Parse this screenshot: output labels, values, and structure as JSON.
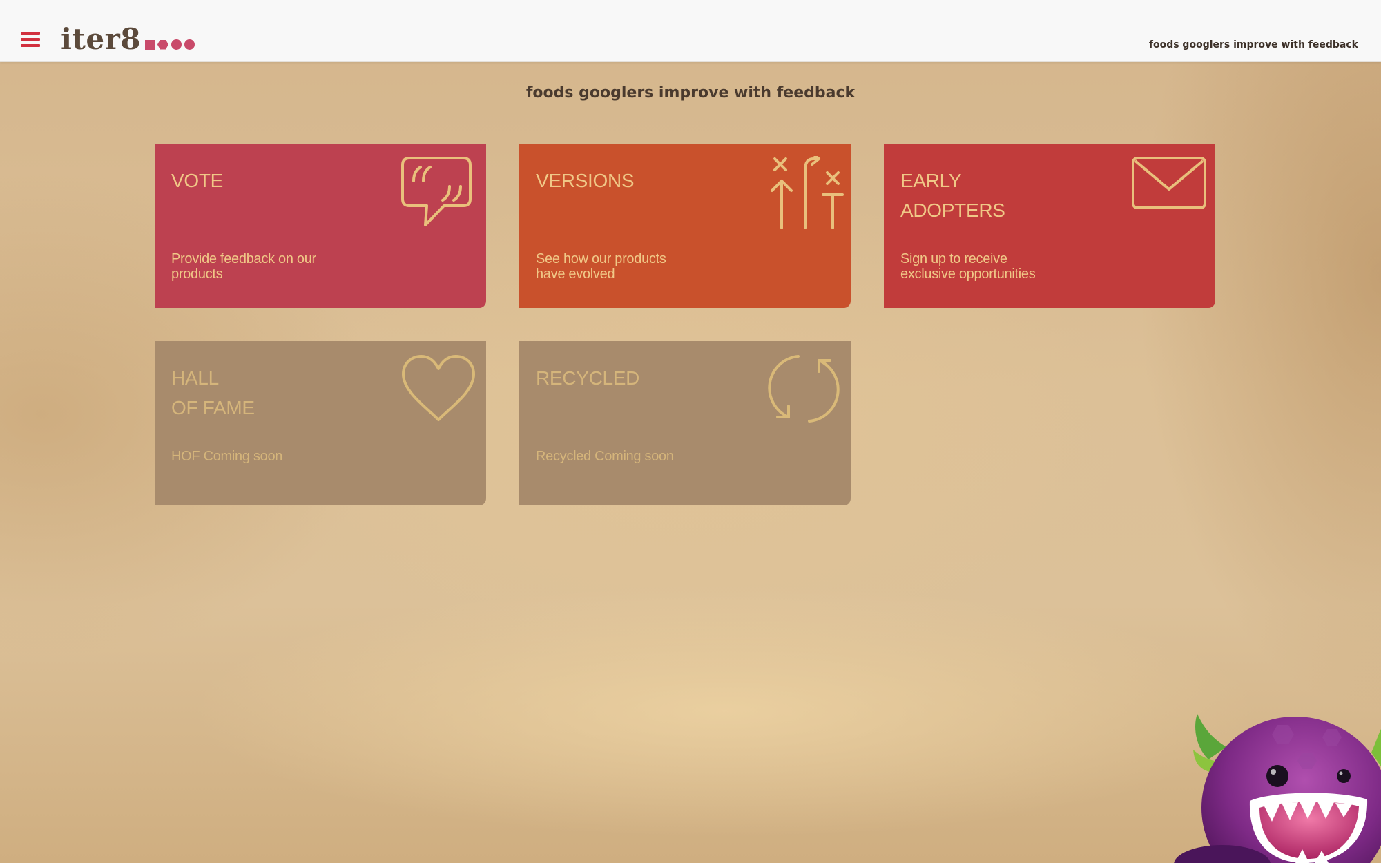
{
  "header": {
    "logo_text": "iter8",
    "tagline": "foods googlers improve with feedback"
  },
  "main": {
    "title": "foods googlers improve with feedback",
    "cards": [
      {
        "title": "VOTE",
        "description": "Provide feedback on our products",
        "icon": "speech-bubble-quote-icon",
        "color": "#bd4150"
      },
      {
        "title": "VERSIONS",
        "description": "See how our products\nhave evolved",
        "icon": "arrows-versions-icon",
        "color": "#c9512c"
      },
      {
        "title": "EARLY\nADOPTERS",
        "description": "Sign up to receive\nexclusive opportunities",
        "icon": "envelope-icon",
        "color": "#c13c3b"
      },
      {
        "title": "HALL\nOF FAME",
        "description": "HOF Coming soon",
        "icon": "heart-icon",
        "color": "#a88b6c"
      },
      {
        "title": "RECYCLED",
        "description": "Recycled Coming soon",
        "icon": "recycle-icon",
        "color": "#a88b6c"
      }
    ]
  },
  "colors": {
    "accent": "#d2313f",
    "icon_stroke": "#e9c07c"
  }
}
